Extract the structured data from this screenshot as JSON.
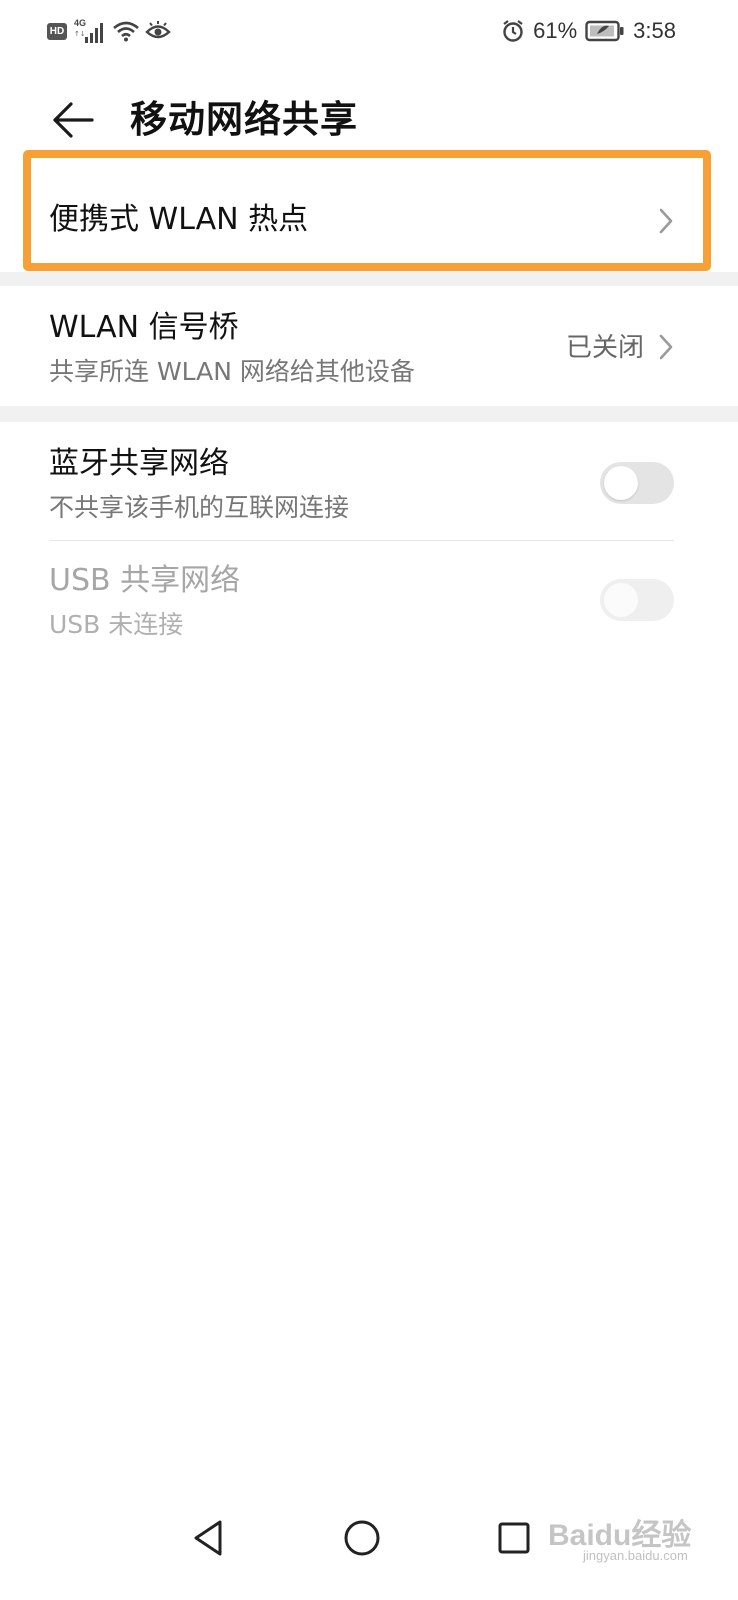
{
  "status_bar": {
    "hd": "HD",
    "network": "4G",
    "network_arrows": "↑↓",
    "battery_percent": "61%",
    "time": "3:58",
    "icons": [
      "hd-icon",
      "signal-icon",
      "wifi-icon",
      "eye-icon",
      "alarm-icon",
      "battery-icon"
    ]
  },
  "header": {
    "title": "移动网络共享",
    "back_icon": "back-arrow-icon"
  },
  "items": {
    "hotspot": {
      "label": "便携式 WLAN 热点",
      "icon": "chevron-right-icon"
    },
    "bridge": {
      "label": "WLAN 信号桥",
      "subtitle": "共享所连 WLAN 网络给其他设备",
      "status": "已关闭",
      "icon": "chevron-right-icon"
    },
    "bluetooth": {
      "label": "蓝牙共享网络",
      "subtitle": "不共享该手机的互联网连接",
      "enabled": false
    },
    "usb": {
      "label": "USB 共享网络",
      "subtitle": "USB 未连接",
      "enabled": false,
      "disabled": true
    }
  },
  "nav_bar": {
    "icons": [
      "nav-back-icon",
      "nav-home-icon",
      "nav-recent-icon"
    ]
  },
  "watermark": {
    "text": "Baidu经验",
    "sub": "jingyan.baidu.com"
  },
  "colors": {
    "highlight": "#f7a035",
    "separator": "#f1f1f1",
    "toggle_off": "#e4e4e4"
  }
}
